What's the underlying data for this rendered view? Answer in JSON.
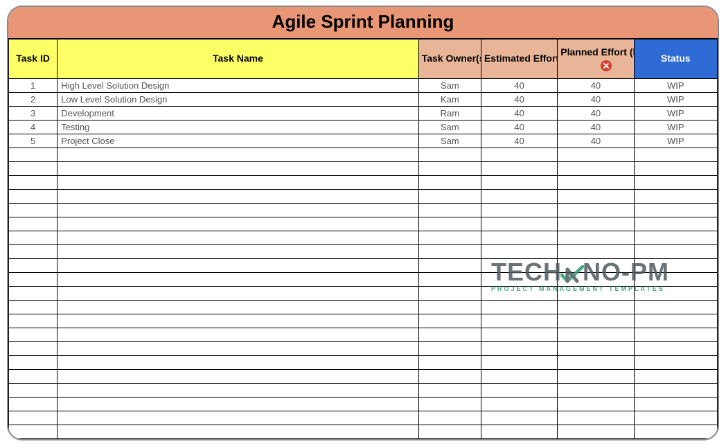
{
  "title": "Agile Sprint Planning",
  "headers": {
    "task_id": "Task ID",
    "task_name": "Task Name",
    "task_owner": "Task Owner(s)",
    "estimated": "Estimated Effort (hrs)",
    "planned": "Planned Effort (hrs)",
    "status": "Status"
  },
  "rows": [
    {
      "id": "1",
      "name": "High Level Solution Design",
      "owner": "Sam",
      "est": "40",
      "plan": "40",
      "status": "WIP"
    },
    {
      "id": "2",
      "name": "Low Level Solution Design",
      "owner": "Kam",
      "est": "40",
      "plan": "40",
      "status": "WIP"
    },
    {
      "id": "3",
      "name": "Development",
      "owner": "Ram",
      "est": "40",
      "plan": "40",
      "status": "WIP"
    },
    {
      "id": "4",
      "name": "Testing",
      "owner": "Sam",
      "est": "40",
      "plan": "40",
      "status": "WIP"
    },
    {
      "id": "5",
      "name": "Project Close",
      "owner": "Sam",
      "est": "40",
      "plan": "40",
      "status": "WIP"
    }
  ],
  "empty_row_count": 21,
  "watermark": {
    "brand_pre": "TEC",
    "brand_mid_h": "H",
    "brand_post": "NO-PM",
    "tag": "PROJECT MANAGEMENT TEMPLATES"
  }
}
